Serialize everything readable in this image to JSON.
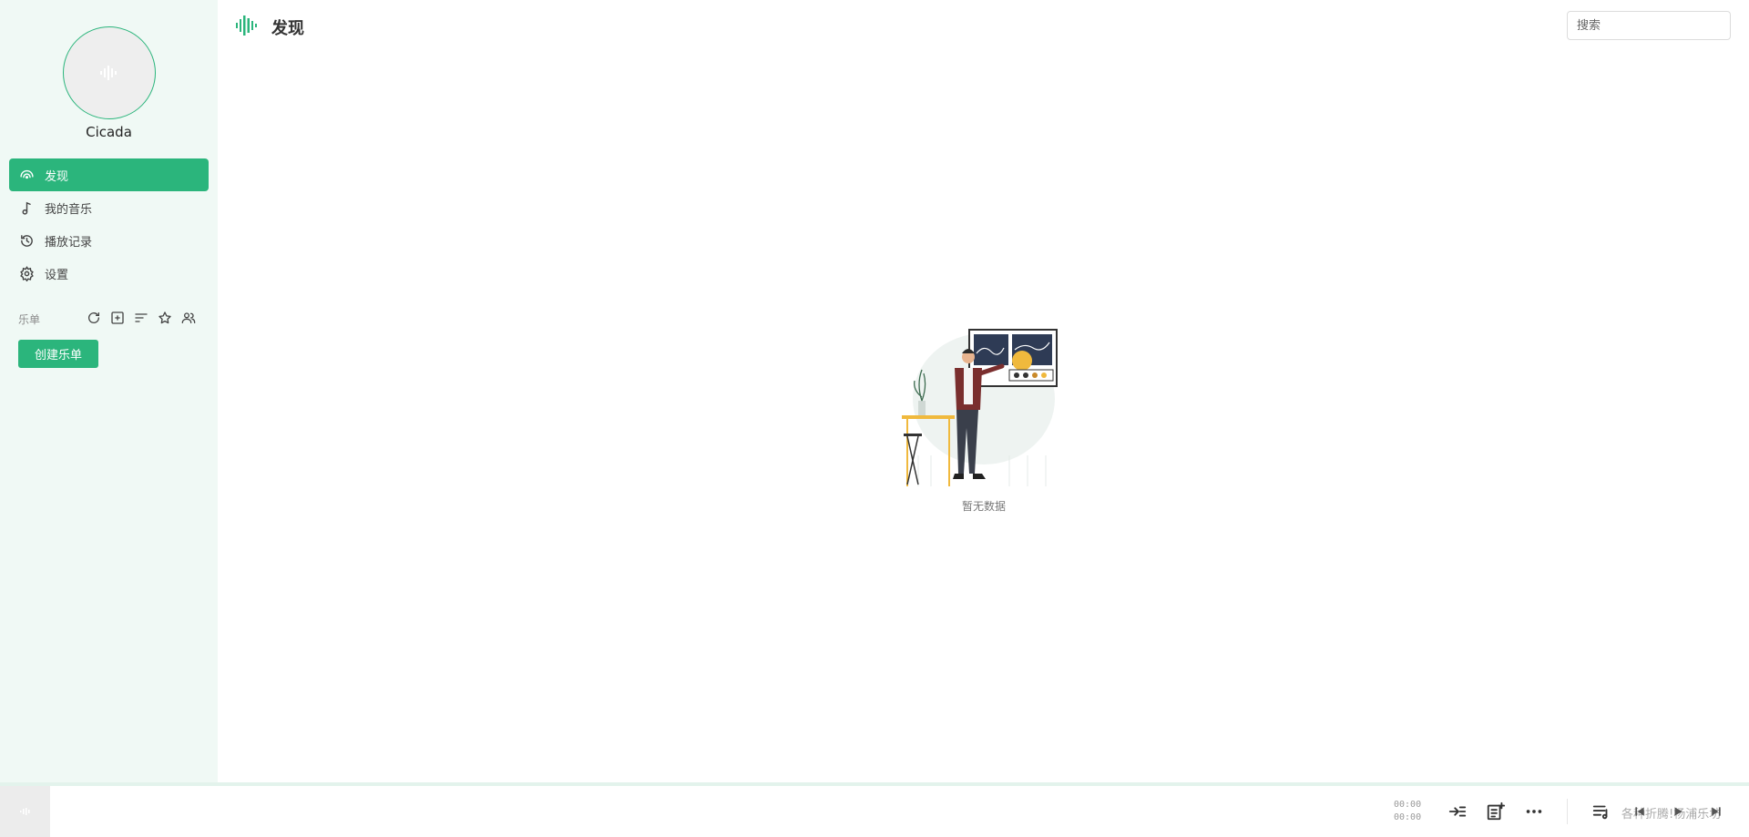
{
  "app": {
    "username": "Cicada"
  },
  "sidebar": {
    "items": [
      {
        "label": "发现",
        "icon": "discover-icon",
        "active": true
      },
      {
        "label": "我的音乐",
        "icon": "music-note-icon",
        "active": false
      },
      {
        "label": "播放记录",
        "icon": "history-icon",
        "active": false
      },
      {
        "label": "设置",
        "icon": "gear-icon",
        "active": false
      }
    ],
    "playlist_section": {
      "label": "乐单",
      "tools": [
        "refresh-icon",
        "add-box-icon",
        "sort-icon",
        "star-icon",
        "people-icon"
      ],
      "create_label": "创建乐单"
    }
  },
  "header": {
    "title": "发现",
    "icon": "soundwave-icon"
  },
  "search": {
    "placeholder": "搜索"
  },
  "main": {
    "empty_text": "暂无数据"
  },
  "player": {
    "current_time": "00:00",
    "duration": "00:00",
    "marquee_text": "各种折腾!杨浦乐坊",
    "buttons": [
      "play-mode-icon",
      "add-to-playlist-icon",
      "more-icon",
      "queue-icon",
      "previous-icon",
      "play-icon",
      "next-icon"
    ]
  },
  "colors": {
    "accent": "#2bb57c",
    "sidebar_bg": "#f0f9f5"
  }
}
